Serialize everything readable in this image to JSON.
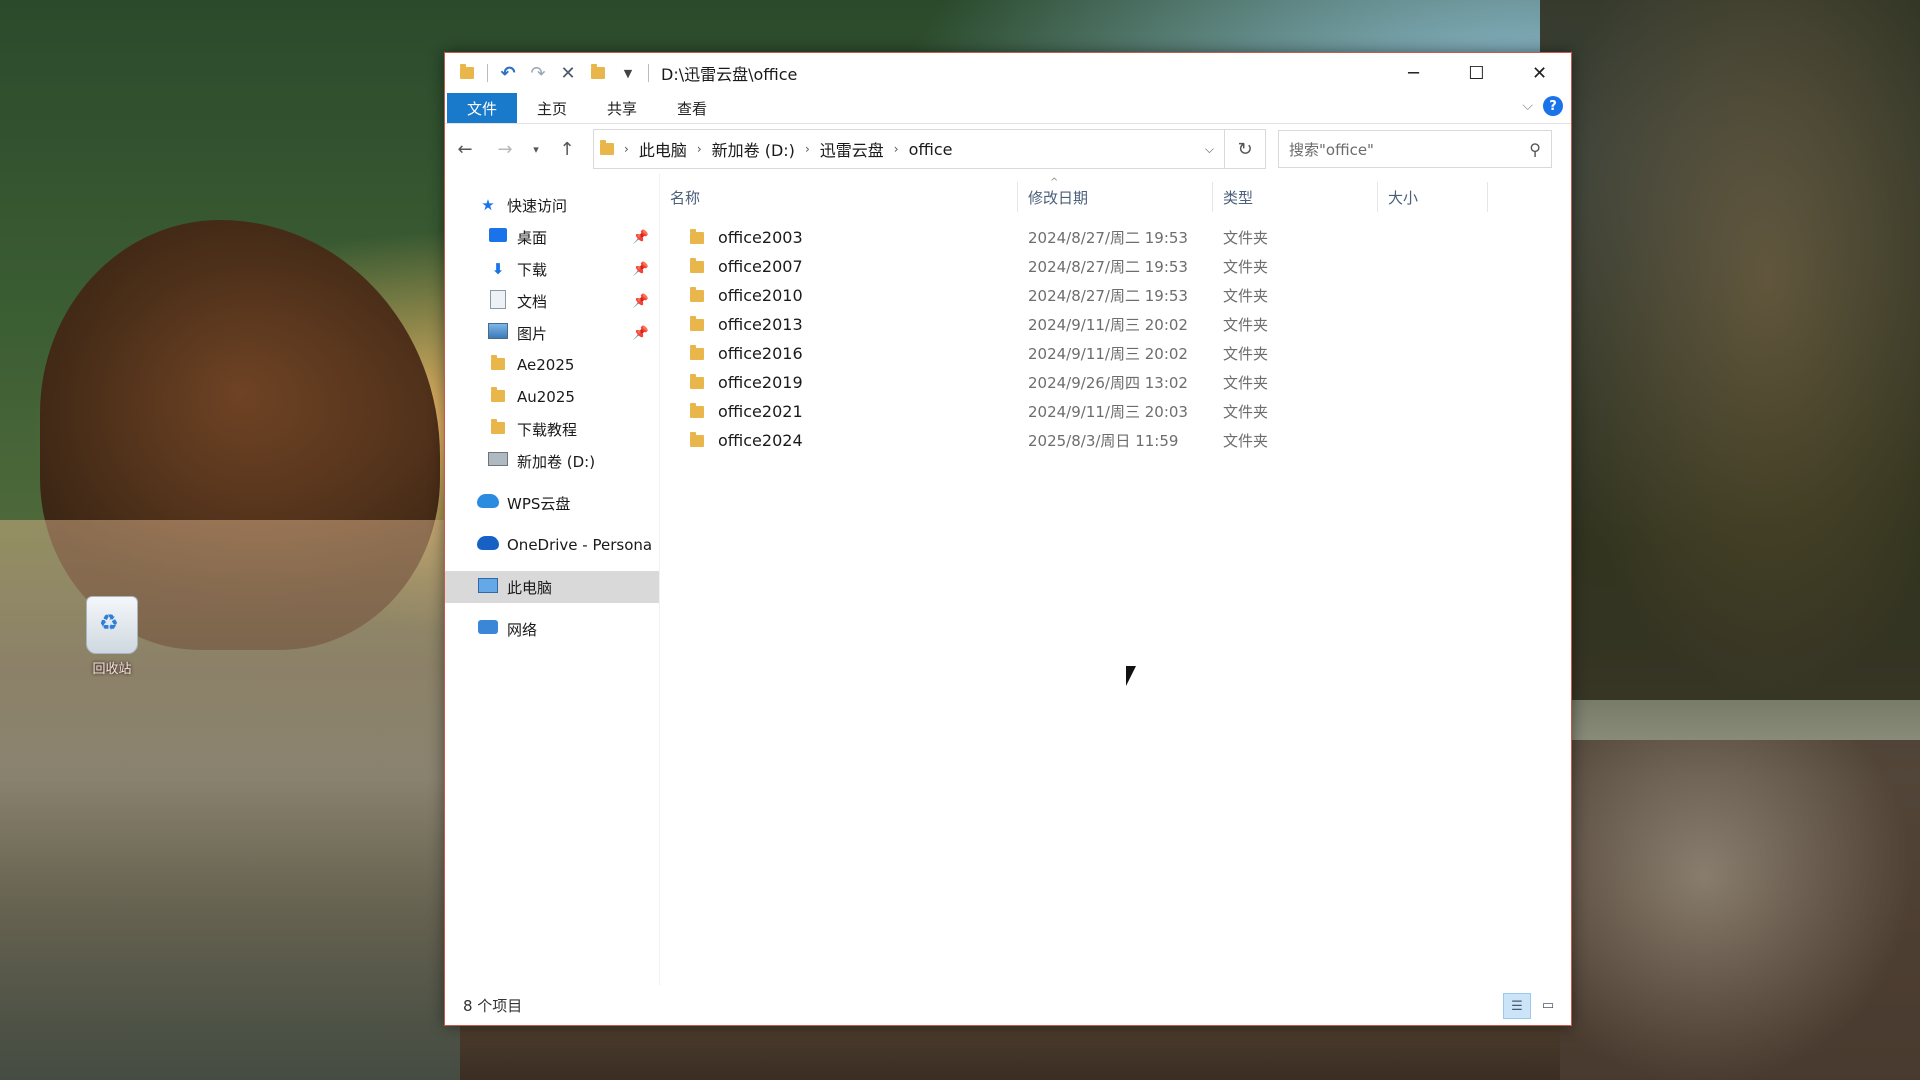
{
  "desktop": {
    "recycle_bin_label": "回收站"
  },
  "window": {
    "title": "D:\\迅雷云盘\\office",
    "controls": {
      "minimize": "─",
      "maximize": "☐",
      "close": "✕"
    }
  },
  "ribbon": {
    "tabs": [
      "文件",
      "主页",
      "共享",
      "查看"
    ],
    "help": "?"
  },
  "navigation": {
    "breadcrumbs": [
      "此电脑",
      "新加卷 (D:)",
      "迅雷云盘",
      "office"
    ],
    "search_placeholder": "搜索\"office\""
  },
  "sidebar": {
    "quick_access": "快速访问",
    "pinned": [
      "桌面",
      "下载",
      "文档",
      "图片"
    ],
    "folders": [
      "Ae2025",
      "Au2025",
      "下载教程"
    ],
    "drive": "新加卷 (D:)",
    "wps": "WPS云盘",
    "onedrive": "OneDrive - Persona",
    "this_pc": "此电脑",
    "network": "网络"
  },
  "columns": {
    "name": "名称",
    "date": "修改日期",
    "type": "类型",
    "size": "大小"
  },
  "files": [
    {
      "name": "office2003",
      "date": "2024/8/27/周二 19:53",
      "type": "文件夹"
    },
    {
      "name": "office2007",
      "date": "2024/8/27/周二 19:53",
      "type": "文件夹"
    },
    {
      "name": "office2010",
      "date": "2024/8/27/周二 19:53",
      "type": "文件夹"
    },
    {
      "name": "office2013",
      "date": "2024/9/11/周三 20:02",
      "type": "文件夹"
    },
    {
      "name": "office2016",
      "date": "2024/9/11/周三 20:02",
      "type": "文件夹"
    },
    {
      "name": "office2019",
      "date": "2024/9/26/周四 13:02",
      "type": "文件夹"
    },
    {
      "name": "office2021",
      "date": "2024/9/11/周三 20:03",
      "type": "文件夹"
    },
    {
      "name": "office2024",
      "date": "2025/8/3/周日 11:59",
      "type": "文件夹"
    }
  ],
  "status": {
    "item_count": "8 个项目"
  },
  "colors": {
    "accent": "#1979ca",
    "folder": "#e8b64a",
    "selected_sidebar": "#d9d9d9"
  }
}
